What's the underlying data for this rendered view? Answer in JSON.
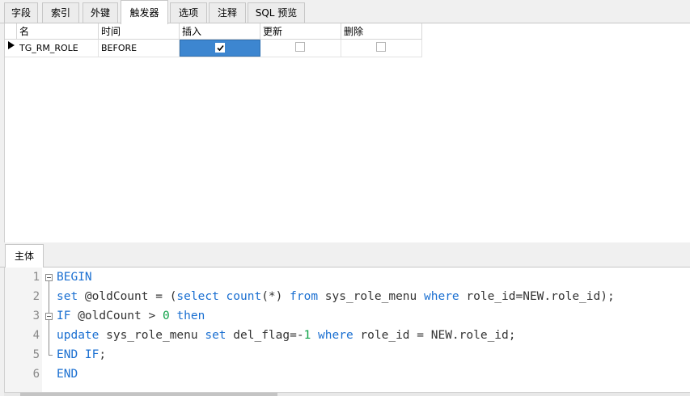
{
  "tabs": [
    {
      "label": "字段"
    },
    {
      "label": "索引"
    },
    {
      "label": "外键"
    },
    {
      "label": "触发器",
      "active": true
    },
    {
      "label": "选项"
    },
    {
      "label": "注释"
    },
    {
      "label": "SQL 预览"
    }
  ],
  "grid": {
    "columns": [
      "名",
      "时间",
      "插入",
      "更新",
      "删除"
    ],
    "rows": [
      {
        "name": "TG_RM_ROLE",
        "time": "BEFORE",
        "insert": true,
        "update": false,
        "delete": false
      }
    ]
  },
  "editor": {
    "tab_label": "主体",
    "line_numbers": [
      "1",
      "2",
      "3",
      "4",
      "5",
      "6"
    ],
    "lines": [
      [
        {
          "t": "BEGIN",
          "k": "kw"
        }
      ],
      [
        {
          "t": "set",
          "k": "kw"
        },
        {
          "t": " @oldCount = (",
          "k": ""
        },
        {
          "t": "select",
          "k": "kw"
        },
        {
          "t": " ",
          "k": ""
        },
        {
          "t": "count",
          "k": "kw"
        },
        {
          "t": "(*) ",
          "k": ""
        },
        {
          "t": "from",
          "k": "kw"
        },
        {
          "t": " sys_role_menu ",
          "k": ""
        },
        {
          "t": "where",
          "k": "kw"
        },
        {
          "t": " role_id=NEW.role_id);",
          "k": ""
        }
      ],
      [
        {
          "t": "IF",
          "k": "kw"
        },
        {
          "t": " @oldCount > ",
          "k": ""
        },
        {
          "t": "0",
          "k": "num"
        },
        {
          "t": " ",
          "k": ""
        },
        {
          "t": "then",
          "k": "kw"
        }
      ],
      [
        {
          "t": "update",
          "k": "kw"
        },
        {
          "t": " sys_role_menu ",
          "k": ""
        },
        {
          "t": "set",
          "k": "kw"
        },
        {
          "t": " del_flag=-",
          "k": ""
        },
        {
          "t": "1",
          "k": "num"
        },
        {
          "t": " ",
          "k": ""
        },
        {
          "t": "where",
          "k": "kw"
        },
        {
          "t": " role_id = NEW.role_id;",
          "k": ""
        }
      ],
      [
        {
          "t": "END IF",
          "k": "kw"
        },
        {
          "t": ";",
          "k": ""
        }
      ],
      [
        {
          "t": "END",
          "k": "kw"
        }
      ]
    ]
  },
  "colors": {
    "keyword": "#1a6fd1",
    "number": "#11a34a",
    "selection": "#3d86d0"
  },
  "icons": {
    "row_indicator": "current-row-arrow-icon",
    "checkbox": "checkbox-icon",
    "fold": "fold-collapse-icon"
  }
}
